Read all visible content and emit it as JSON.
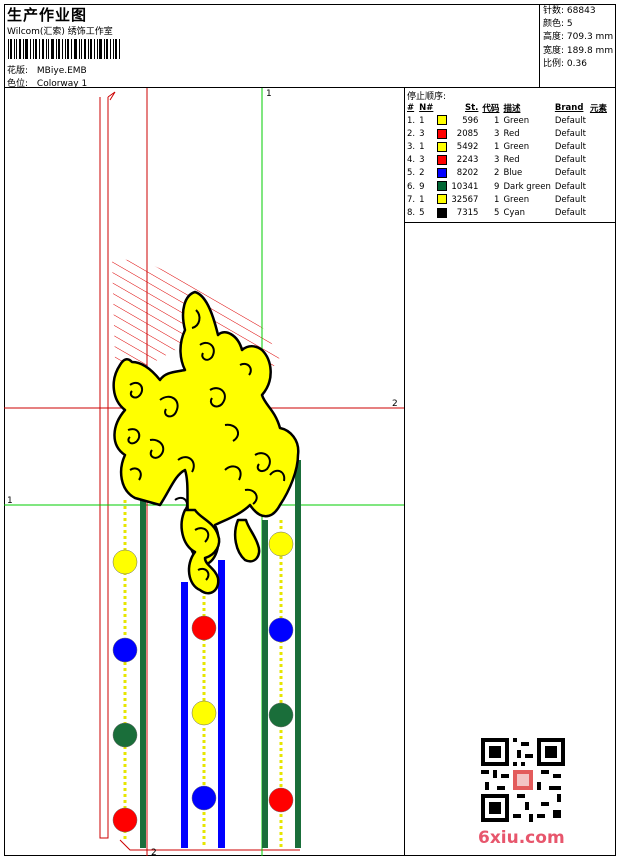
{
  "header": {
    "title": "生产作业图",
    "subtitle": "Wilcom(汇索) 绣饰工作室",
    "design_label": "花版:",
    "design_value": "MBiye.EMB",
    "colorway_label": "色位:",
    "colorway_value": "Colorway 1"
  },
  "stats": [
    {
      "label": "针数:",
      "value": "68843"
    },
    {
      "label": "颜色:",
      "value": "5"
    },
    {
      "label": "高度:",
      "value": "709.3 mm"
    },
    {
      "label": "宽度:",
      "value": "189.8 mm"
    },
    {
      "label": "比例:",
      "value": "0.36"
    }
  ],
  "stop_sequence": {
    "title": "停止顺序:",
    "headers": {
      "num": "#",
      "needle": "N#",
      "stitches": "St.",
      "code": "代码",
      "desc": "描述",
      "brand": "Brand",
      "elements": "元素"
    },
    "rows": [
      {
        "num": "1.",
        "needle": "1",
        "color": "#ffff00",
        "stitches": "596",
        "code": "1",
        "desc": "Green",
        "brand": "Default"
      },
      {
        "num": "2.",
        "needle": "3",
        "color": "#ff0000",
        "stitches": "2085",
        "code": "3",
        "desc": "Red",
        "brand": "Default"
      },
      {
        "num": "3.",
        "needle": "1",
        "color": "#ffff00",
        "stitches": "5492",
        "code": "1",
        "desc": "Green",
        "brand": "Default"
      },
      {
        "num": "4.",
        "needle": "3",
        "color": "#ff0000",
        "stitches": "2243",
        "code": "3",
        "desc": "Red",
        "brand": "Default"
      },
      {
        "num": "5.",
        "needle": "2",
        "color": "#0000ff",
        "stitches": "8202",
        "code": "2",
        "desc": "Blue",
        "brand": "Default"
      },
      {
        "num": "6.",
        "needle": "9",
        "color": "#006633",
        "stitches": "10341",
        "code": "9",
        "desc": "Dark green",
        "brand": "Default"
      },
      {
        "num": "7.",
        "needle": "1",
        "color": "#ffff00",
        "stitches": "32567",
        "code": "1",
        "desc": "Green",
        "brand": "Default"
      },
      {
        "num": "8.",
        "needle": "5",
        "color": "#000000",
        "stitches": "7315",
        "code": "5",
        "desc": "Cyan",
        "brand": "Default"
      }
    ]
  },
  "guides": {
    "top": "1",
    "right": "2",
    "left": "1",
    "bottom": "2"
  },
  "watermark": "6xiu.com",
  "colors": {
    "yellow": "#ffff00",
    "red": "#ff0000",
    "blue": "#0000ff",
    "dark_green": "#1a6e3a",
    "guide_green": "#00cc00",
    "guide_red": "#cc0000"
  }
}
